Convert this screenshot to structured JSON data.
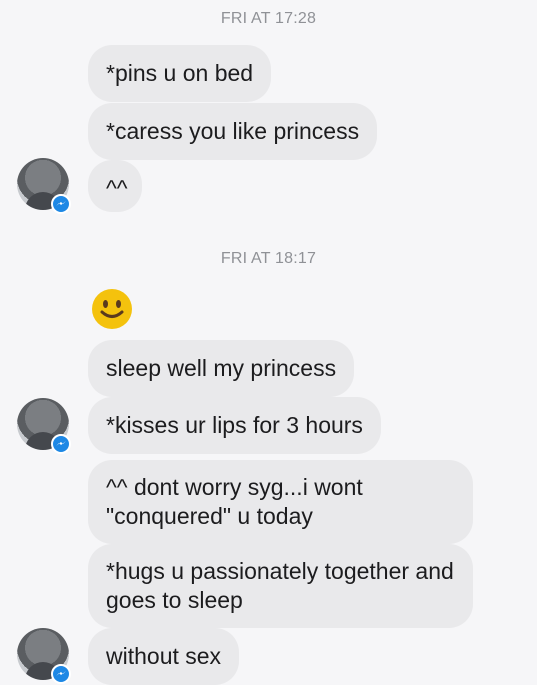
{
  "conversation": {
    "timestamps": [
      "FRI AT 17:28",
      "FRI AT 18:17"
    ],
    "messages": [
      "*pins u on bed",
      "*caress you like princess",
      "^^",
      "sleep well my princess",
      "*kisses ur lips for 3 hours",
      "^^ dont worry syg...i wont \"conquered\" u today",
      "*hugs u passionately together and goes to sleep",
      "without sex"
    ],
    "sticker": {
      "emoji": "smiling-face-icon"
    }
  },
  "colors": {
    "background": "#f6f6f8",
    "bubble": "#e9e9eb",
    "text": "#1c1c1e",
    "timestamp": "#8f9196",
    "messenger_badge": "#1e88e5",
    "emoji_yellow": "#f4c20d"
  }
}
